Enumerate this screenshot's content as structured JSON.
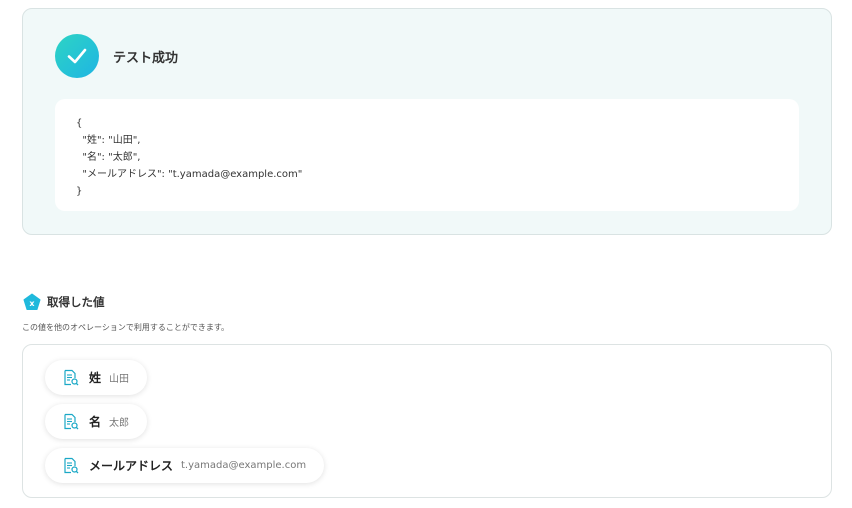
{
  "result": {
    "title": "テスト成功",
    "json_lines": "{\n  \"姓\": \"山田\",\n  \"名\": \"太郎\",\n  \"メールアドレス\": \"t.yamada@example.com\"\n}"
  },
  "values": {
    "title": "取得した値",
    "description": "この値を他のオペレーションで利用することができます。",
    "items": [
      {
        "key": "姓",
        "value": "山田"
      },
      {
        "key": "名",
        "value": "太郎"
      },
      {
        "key": "メールアドレス",
        "value": "t.yamada@example.com"
      }
    ]
  },
  "colors": {
    "accent": "#1fc1d6",
    "card_bg": "#f1f9f9"
  },
  "icons": {
    "success": "check-icon",
    "values": "pentagon-x-icon",
    "chip": "document-search-icon"
  }
}
